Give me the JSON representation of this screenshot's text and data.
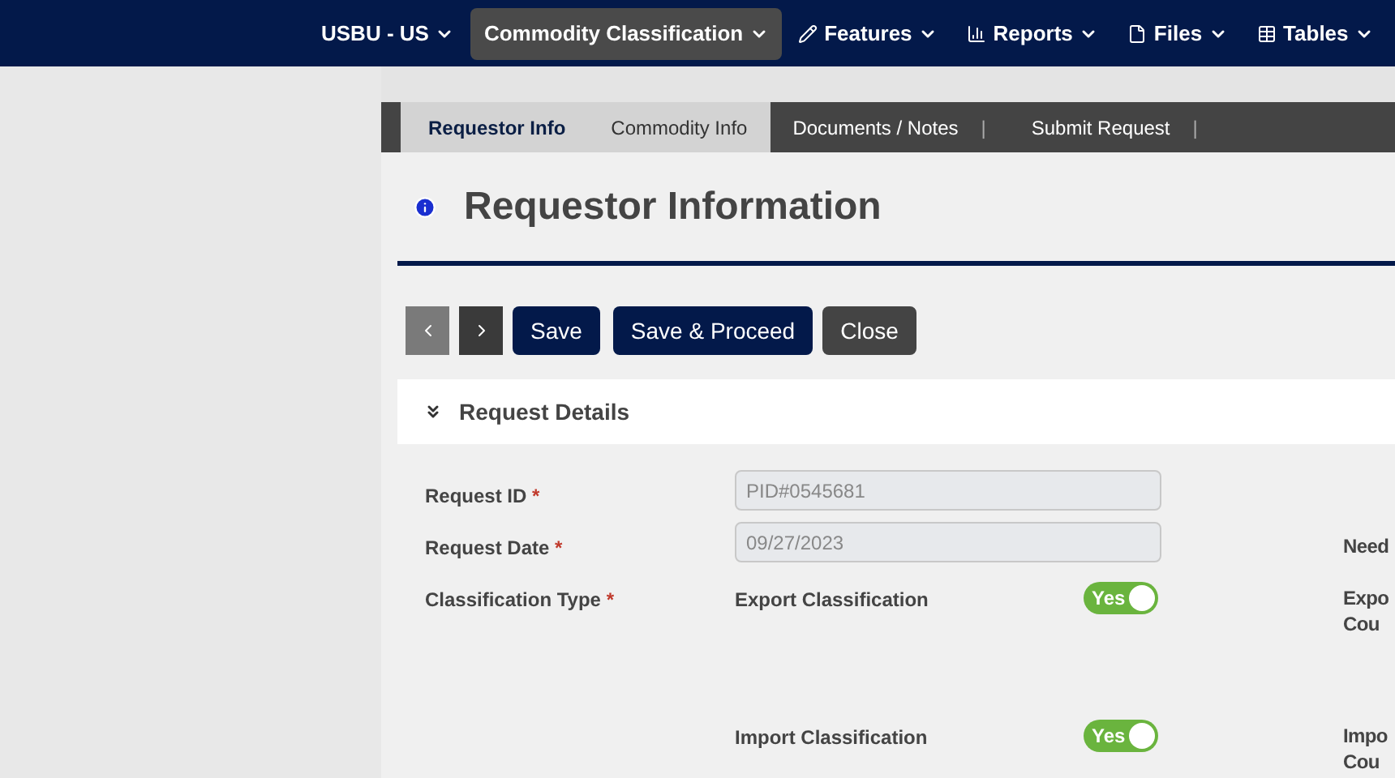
{
  "navbar": {
    "items": [
      {
        "label": "USBU - US",
        "selected": false
      },
      {
        "label": "Commodity Classification",
        "selected": true
      },
      {
        "label": "Features",
        "selected": false
      },
      {
        "label": "Reports",
        "selected": false
      },
      {
        "label": "Files",
        "selected": false
      },
      {
        "label": "Tables",
        "selected": false
      }
    ]
  },
  "tabs": [
    {
      "label": "Requestor Info",
      "selected": true,
      "available": true
    },
    {
      "label": "Commodity Info",
      "selected": false,
      "available": true
    },
    {
      "label": "Documents / Notes",
      "selected": false,
      "available": false,
      "separator": "|"
    },
    {
      "label": "Submit Request",
      "selected": false,
      "available": false,
      "separator": "|"
    }
  ],
  "page_title": "Requestor Information",
  "toolbar": {
    "prev_disabled": true,
    "buttons": [
      {
        "label": "Save",
        "kind": "primary"
      },
      {
        "label": "Save & Proceed",
        "kind": "primary"
      },
      {
        "label": "Close",
        "kind": "secondary"
      }
    ]
  },
  "section": {
    "title": "Request Details",
    "expanded": true
  },
  "fields": [
    {
      "label": "Request ID",
      "required_mark": "*",
      "value": "PID#0545681"
    },
    {
      "label": "Request Date",
      "required_mark": "*",
      "value": "09/27/2023",
      "right_label": [
        "Need"
      ]
    }
  ],
  "classification": {
    "label": "Classification Type",
    "required_mark": "*",
    "options": [
      {
        "label": "Export Classification",
        "on": true,
        "toggle_text": "Yes",
        "right_label": [
          "Expo",
          "Cou"
        ]
      },
      {
        "label": "Import Classification",
        "on": true,
        "toggle_text": "Yes",
        "right_label": [
          "Impo",
          "Cou"
        ]
      }
    ]
  }
}
